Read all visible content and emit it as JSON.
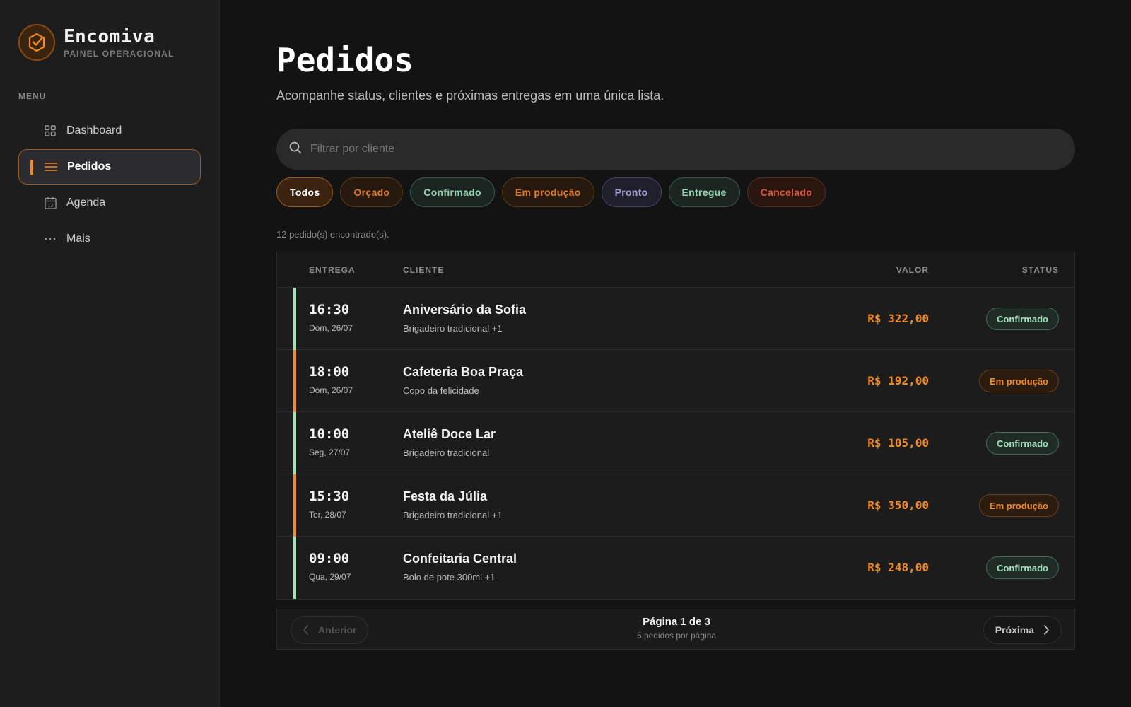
{
  "brand": {
    "name": "Encomiva",
    "subtitle": "PAINEL OPERACIONAL",
    "accent": "#f08a24"
  },
  "sidebar": {
    "menu_label": "MENU",
    "items": [
      {
        "label": "Dashboard",
        "icon": "grid-icon",
        "active": false
      },
      {
        "label": "Pedidos",
        "icon": "list-icon",
        "active": true
      },
      {
        "label": "Agenda",
        "icon": "calendar-icon",
        "active": false
      },
      {
        "label": "Mais",
        "icon": "more-icon",
        "active": false
      }
    ]
  },
  "header": {
    "title": "Pedidos",
    "subtitle": "Acompanhe status, clientes e próximas entregas em uma única lista."
  },
  "search": {
    "placeholder": "Filtrar por cliente",
    "value": ""
  },
  "filters": [
    {
      "label": "Todos",
      "color": "#ffffff",
      "bg": "#3a2410",
      "border": "#a25a18"
    },
    {
      "label": "Orçado",
      "color": "#e07d22",
      "bg": "#26190e",
      "border": "#5e3a18"
    },
    {
      "label": "Confirmado",
      "color": "#9ad3b4",
      "bg": "#1b2621",
      "border": "#3f5a4c"
    },
    {
      "label": "Em produção",
      "color": "#e07d22",
      "bg": "#26190e",
      "border": "#5e3a18"
    },
    {
      "label": "Pronto",
      "color": "#a4a0d6",
      "bg": "#20202c",
      "border": "#47456b"
    },
    {
      "label": "Entregue",
      "color": "#9ad3b4",
      "bg": "#1b2621",
      "border": "#3f5a4c"
    },
    {
      "label": "Cancelado",
      "color": "#e0553d",
      "bg": "#28160f",
      "border": "#5e2a1e"
    }
  ],
  "result_count": "12 pedido(s) encontrado(s).",
  "table": {
    "columns": {
      "delivery": "ENTREGA",
      "client": "CLIENTE",
      "value": "VALOR",
      "status": "STATUS"
    },
    "rows": [
      {
        "time": "16:30",
        "date": "Dom, 26/07",
        "client": "Aniversário da Sofia",
        "product": "Brigadeiro tradicional +1",
        "value": "R$ 322,00",
        "status": "Confirmado",
        "status_kind": "confirmed"
      },
      {
        "time": "18:00",
        "date": "Dom, 26/07",
        "client": "Cafeteria Boa Praça",
        "product": "Copo da felicidade",
        "value": "R$ 192,00",
        "status": "Em produção",
        "status_kind": "production"
      },
      {
        "time": "10:00",
        "date": "Seg, 27/07",
        "client": "Ateliê Doce Lar",
        "product": "Brigadeiro tradicional",
        "value": "R$ 105,00",
        "status": "Confirmado",
        "status_kind": "confirmed"
      },
      {
        "time": "15:30",
        "date": "Ter, 28/07",
        "client": "Festa da Júlia",
        "product": "Brigadeiro tradicional +1",
        "value": "R$ 350,00",
        "status": "Em produção",
        "status_kind": "production"
      },
      {
        "time": "09:00",
        "date": "Qua, 29/07",
        "client": "Confeitaria Central",
        "product": "Bolo de pote 300ml +1",
        "value": "R$ 248,00",
        "status": "Confirmado",
        "status_kind": "confirmed"
      }
    ]
  },
  "status_colors": {
    "confirmed": {
      "bar": "#9ee6b8",
      "text": "#a8e2c0",
      "bg": "#1e2c25",
      "border": "#4a6a58"
    },
    "production": {
      "bar": "#f08a24",
      "text": "#f08a24",
      "bg": "#2c1c0f",
      "border": "#6a3e17"
    }
  },
  "value_color": "#f08a24",
  "pagination": {
    "prev_label": "Anterior",
    "next_label": "Próxima",
    "page_text": "Página 1 de 3",
    "per_page_text": "5 pedidos por página"
  }
}
